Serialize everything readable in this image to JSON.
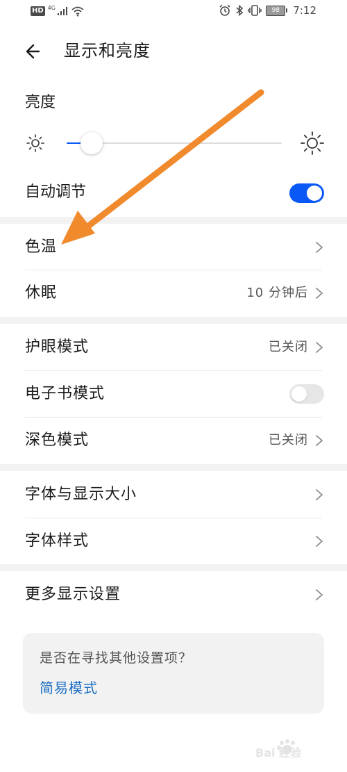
{
  "status_bar": {
    "hd": "HD",
    "network": "4G",
    "battery": "98",
    "time": "7:12"
  },
  "header": {
    "title": "显示和亮度"
  },
  "brightness": {
    "title": "亮度",
    "level": 0.05
  },
  "auto_adjust": {
    "label": "自动调节",
    "on": true
  },
  "rows": {
    "color_temp": {
      "label": "色温"
    },
    "sleep": {
      "label": "休眠",
      "value": "10 分钟后"
    },
    "eye_comfort": {
      "label": "护眼模式",
      "value": "已关闭"
    },
    "ebook": {
      "label": "电子书模式",
      "on": false
    },
    "dark_mode": {
      "label": "深色模式",
      "value": "已关闭"
    },
    "font_size": {
      "label": "字体与显示大小"
    },
    "font_style": {
      "label": "字体样式"
    },
    "more_display": {
      "label": "更多显示设置"
    }
  },
  "suggestion": {
    "question": "是否在寻找其他设置项？",
    "link": "简易模式"
  },
  "colors": {
    "accent": "#0a59f7",
    "link": "#1a6fc4",
    "annotation_arrow": "#f08a2c"
  },
  "watermark": {
    "text": "Bai 经验"
  }
}
